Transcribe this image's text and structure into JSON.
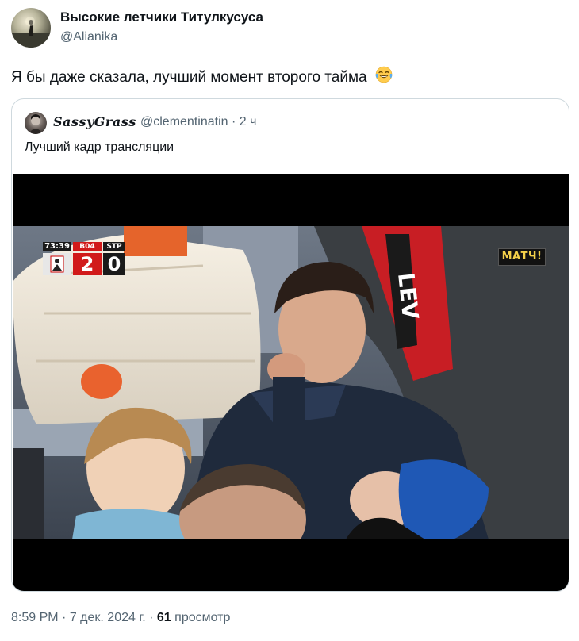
{
  "author": {
    "name": "Высокие летчики Титулкусуса",
    "handle": "@Alianika"
  },
  "tweet": {
    "text": "Я бы даже сказала, лучший момент второго тайма",
    "emoji": "face-with-tears-of-joy"
  },
  "quote": {
    "name": "SassyGrass",
    "handle": "@clementinatin",
    "time_ago": "2 ч",
    "text": "Лучший кадр трансляции",
    "scorebug": {
      "time": "73:39",
      "team1": "B04",
      "team2": "STP",
      "score1": "2",
      "score2": "0"
    },
    "channel_logo": "МАТЧ!"
  },
  "footer": {
    "time": "8:59 PM",
    "date": "7 дек. 2024 г.",
    "views_count": "61",
    "views_label": "просмотр"
  },
  "colors": {
    "text_primary": "#0f1419",
    "text_secondary": "#536471",
    "border": "#cfd9de",
    "scorebug_red": "#d11a1a"
  }
}
